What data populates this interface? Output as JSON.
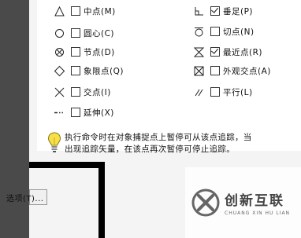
{
  "snap_modes_left": [
    {
      "label": "中点(M)",
      "checked": false,
      "icon": "midpoint-triangle-icon"
    },
    {
      "label": "圆心(C)",
      "checked": false,
      "icon": "center-circle-icon"
    },
    {
      "label": "节点(D)",
      "checked": false,
      "icon": "node-icon"
    },
    {
      "label": "象限点(Q)",
      "checked": false,
      "icon": "quadrant-diamond-icon"
    },
    {
      "label": "交点(I)",
      "checked": false,
      "icon": "intersection-x-icon"
    },
    {
      "label": "延伸(X)",
      "checked": false,
      "icon": "extension-icon"
    }
  ],
  "snap_modes_right": [
    {
      "label": "垂足(P)",
      "checked": true,
      "icon": "perpendicular-icon"
    },
    {
      "label": "切点(N)",
      "checked": false,
      "icon": "tangent-icon"
    },
    {
      "label": "最近点(R)",
      "checked": true,
      "icon": "nearest-hourglass-icon"
    },
    {
      "label": "外观交点(A)",
      "checked": false,
      "icon": "apparent-intersection-icon"
    },
    {
      "label": "平行(L)",
      "checked": false,
      "icon": "parallel-icon"
    }
  ],
  "hint": {
    "line1": "执行命令时在对象捕捉点上暂停可从该点追踪，当",
    "line2": "出现追踪矢量，在该点再次暂停可停止追踪。",
    "icon": "lightbulb-icon"
  },
  "options_button": {
    "label": "选项(T)..."
  },
  "watermark": {
    "brand": "创新互联",
    "sub": "CHUANG XIN HU LIAN",
    "icon": "brand-logo-icon"
  }
}
